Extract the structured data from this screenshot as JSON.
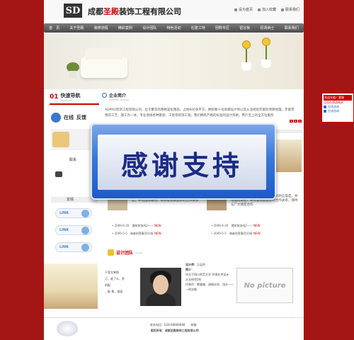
{
  "header": {
    "logo_text": "SD",
    "company_name_pre": "成都",
    "company_name_highlight": "圣殿",
    "company_name_post": "装饰工程有限公司",
    "top_links": [
      "设为首页",
      "加入收藏",
      "联系我们"
    ]
  },
  "nav": {
    "items": [
      "首　页",
      "关于圣殿",
      "装修流程",
      "精彩案例",
      "设计团队",
      "特色活动",
      "在建工地",
      "团购专区",
      "留言板",
      "招贤纳士",
      "联系我们"
    ]
  },
  "banner": {
    "indicators": [
      "1",
      "2",
      "3"
    ]
  },
  "quick_nav": {
    "num": "01",
    "title": "快速导航",
    "subtitle": "PRODUCTS",
    "online_service": "在线",
    "online_service_2": "反馈",
    "contact_label": "联系",
    "links_label": "友情",
    "link_buttons": [
      "LINK",
      "LINK",
      "LINK"
    ]
  },
  "about": {
    "title": "企业简介",
    "subtitle": "COMPANY PROFILE",
    "text": "ADPRO装饰工程有限公司，位于繁华的香格里拉南段。占地600多平方，拥有数十位高端设计师以及从业经验丰富的项目经理，丰富完善的工艺，施工为一体，专业承接各种家装、工装等装饰工程。我们拥有严格的标准的设计风格，用户至上的全方位服务"
  },
  "news": {
    "left_text": "多年的经营活动，在业内以其专业有良好的信誉度，并与国际著名厂商有着长期良好的合作关系",
    "right_text": "经营活动，在业内以其专业有良好的信誉度，并与国际著名厂商有着长期良好的合作关系，期待与广大朋友合作",
    "right_header": "社项目经过严",
    "left_list": [
      {
        "date": "2009-6-20",
        "title": "通知装饰AJ2——",
        "tag": "NEW"
      },
      {
        "date": "2009-5-5",
        "title": "骑者经营事项10条",
        "tag": "NEW"
      }
    ],
    "right_list": [
      {
        "date": "2009-6-20",
        "title": "通知装饰AJ2——",
        "tag": "NEW"
      },
      {
        "date": "2009-5-5",
        "title": "骑者经营事项10条",
        "tag": "NEW"
      }
    ]
  },
  "design": {
    "title": "设计团队",
    "subtitle": "Design",
    "left_caption_lines": [
      "干室交果照",
      "订，谁了么、罗",
      "的配",
      "，配 果，很面"
    ],
    "designer_info": [
      {
        "label": "设计师：",
        "value": "王运杰"
      },
      {
        "label": "简介：",
        "value": ""
      },
      {
        "label": "",
        "value": "毕业于四川师范大学 环境艺术设计"
      },
      {
        "label": "",
        "value": "从业经验5年"
      },
      {
        "label": "",
        "value": "代表作：熊猫城、成城水岸、浅水——一的详细"
      }
    ],
    "no_picture": "No picture"
  },
  "footer": {
    "line1": "联系电话：028-88888888　　邮箱：",
    "line2": "版权所有：成都圣殿装饰工程有限公司"
  },
  "tooltip": {
    "header": "欢迎光临！客服",
    "sub": "点击在线咨询本",
    "items": [
      "在线咨询",
      "在线咨询"
    ]
  },
  "popup": {
    "text": "感谢支持"
  },
  "colors": {
    "background": "#a41616",
    "accent": "#c00000",
    "popup_blue": "#1d58c8"
  }
}
